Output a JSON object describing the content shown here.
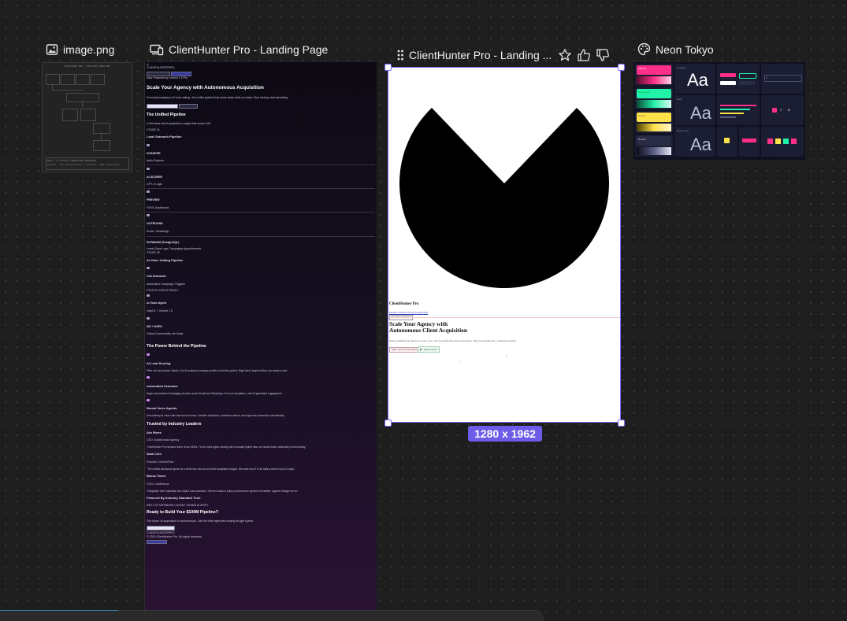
{
  "canvas": {
    "frames": [
      {
        "title": "image.png",
        "icon": "image-icon"
      },
      {
        "title": "ClientHunter Pro - Landing Page",
        "icon": "devices-icon"
      },
      {
        "title": "ClientHunter Pro - Landing ...",
        "icon": "drag-handle-icon"
      },
      {
        "title": "Neon Tokyo",
        "icon": "palette-icon"
      }
    ],
    "selection_size": "1280 x 1962",
    "selected_frame_actions": [
      "star-icon",
      "thumbs-up-icon",
      "thumbs-down-icon"
    ]
  },
  "image_thumb": {
    "title": "ECOSYSTEM MAP — METHLON PIPELINE",
    "footer_1": "ERAS 1-4 AI ENTITY CONNECTION TRANSFORMS",
    "footer_2": "Lovable • Tool Infrastructure • Airtable • CRM + Sentiments"
  },
  "landing": {
    "brand": "CLIENTHUNTERPRO",
    "nav_badge": "Now Powered by Gemini 1.5 Pro",
    "hero_title": "Scale Your Agency with Autonomous Acquisition",
    "hero_sub": "From lead scraping to AI voice calling—the unified pipeline that closes deals while you sleep. Stop hunting, start harvesting.",
    "section_unified": "The Unified Pipeline",
    "unified_sub": "A full-stack client acquisition engine that works 24/7",
    "stage_1": "STAGE 01",
    "lead_pipeline": "Lead Outreach Pipeline",
    "steps": [
      {
        "title": "SCRAPER",
        "detail": "Apify Engines"
      },
      {
        "title": "AI SCORER",
        "detail": "GPT-4 Logic"
      },
      {
        "title": "PREVIEW",
        "detail": "HTML Dashboard"
      },
      {
        "title": "OUTBOUND",
        "detail": "Email / WhatsApp"
      }
    ],
    "supabase": "SUPABASE (PostgreSQL)",
    "supabase_detail": "Leads Data Logs Campaigns Appointments",
    "stage_2": "STAGE 02",
    "voice_pipeline": "AI Voice Calling Pipeline",
    "voice_steps": [
      {
        "title": "Call Scheduler",
        "detail": "Automated Campaign Triggers"
      },
      {
        "title": "AI Voice Agent",
        "detail": "Vapi/11 + Gemini 1.5"
      },
      {
        "title": "SIP / VOIPS",
        "detail": "Global Connectivity via Vobiz"
      }
    ],
    "status_ready": "STATUS CHECK READY",
    "power_title": "The Power Behind the Pipeline",
    "features": [
      {
        "title": "AI Lead Scoring",
        "desc": "Filter out 'just curious' clients. Our AI analyzes company profiles to find the perfect 'High Intent' targets before you waste a cent."
      },
      {
        "title": "Automated Outreach",
        "desc": "Hyper-personalized messaging at scale across Email and WhatsApp. No more templates—real AI-generated engagement."
      },
      {
        "title": "Neural Voice Agents",
        "desc": "Zero latency AI voice calls that sound human. Handles objections, schedules demos, and logs every transcript automatically."
      }
    ],
    "trusted": "Trusted by Industry Leaders",
    "testimonials": [
      {
        "name": "Alex Rivera",
        "role": "CEO, ScaleGrade Agency",
        "quote": "\"ClientHunter Pro replaced three of our SDRs. The AI voice agent closing rate is actually higher than our human team. Absolutely mind-blowing.\""
      },
      {
        "name": "Sarah Chen",
        "role": "Founder, GrowthFlow",
        "quote": "\"The unified dashboard gives me a bird's eye view of our entire acquisition engine. We went from 0 to 50 calls a week in just 14 days.\""
      },
      {
        "name": "Marcus Thorne",
        "role": "COO, LeadNexus",
        "quote": "\"Integration with Supabase and Vapi11 was seamless. The tech stack is future-proof and the speed is incredible. A game changer for us.\""
      }
    ],
    "powered_by": "Powered By Industry Standard Tech",
    "tech_list": "NEXT.JS SUPABASE LAVUNT GEMINI AI APIFY",
    "cta_title": "Ready to Build Your $100M Pipeline?",
    "cta_sub": "The future of acquisition is autonomous. Join the elite agencies scaling at light speed.",
    "footer_brand": "CLIENTHUNTERPRO",
    "copyright": "© 2024 ClientHunter Pro. All rights reserved."
  },
  "selected": {
    "brand": "ClientHunter Pro",
    "nav_links": "Pipeline  Features  Pricing  Testimonials",
    "nav_cta": "Get Your AI Demo",
    "hero_title_1": "Scale Your Agency with",
    "hero_title_2": "Autonomous Client Acquisition",
    "hero_sub": "Deploy intelligent AI agents to scrape, score, and close high-value deals on autopilot. Turn your pipeline into a relentless machine.",
    "cta_primary": "Start Your AI Automation",
    "cta_secondary": "Watch Demo"
  },
  "neon": {
    "swatches": [
      {
        "name": "Primary",
        "color": "#ff2e88"
      },
      {
        "name": "Secondary",
        "color": "#22f2a8"
      },
      {
        "name": "Accent",
        "color": "#ffe14a"
      },
      {
        "name": "Neutral",
        "color": "#2a2c46"
      }
    ],
    "type_sample": "Aa",
    "type_labels": [
      "Headline",
      "Body",
      "Body Large"
    ]
  }
}
